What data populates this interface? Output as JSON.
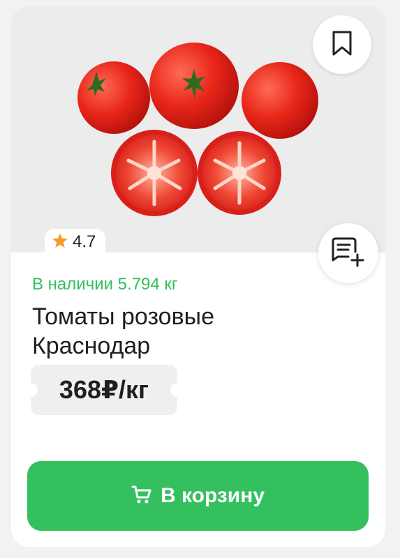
{
  "product": {
    "rating": "4.7",
    "stock_text": "В наличии 5.794 кг",
    "title": "Томаты розовые Краснодар",
    "price": "368₽/кг"
  },
  "actions": {
    "add_to_cart_label": "В корзину"
  },
  "icons": {
    "bookmark": "bookmark-icon",
    "list_add": "list-add-icon",
    "star": "star-icon",
    "cart": "cart-icon"
  },
  "colors": {
    "accent_green": "#34c05f",
    "stock_green": "#2fbf5b",
    "star_orange": "#f59a23",
    "price_bg": "#efefef"
  }
}
